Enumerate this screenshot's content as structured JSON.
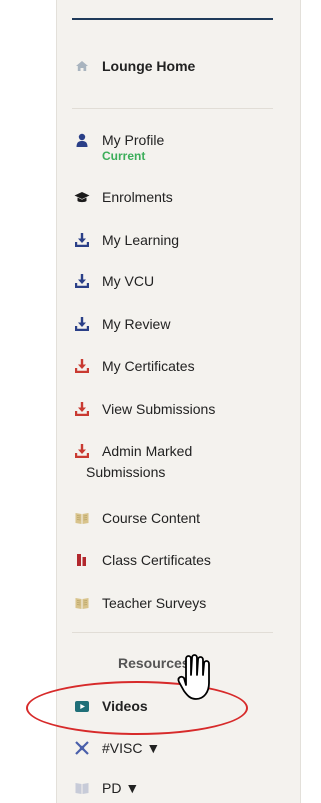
{
  "nav": {
    "home": "Lounge Home",
    "profile": {
      "label": "My Profile",
      "status": "Current"
    },
    "enrolments": "Enrolments",
    "my_learning": "My Learning",
    "my_vcu": "My VCU",
    "my_review": "My Review",
    "my_certificates": "My Certificates",
    "view_submissions": "View Submissions",
    "admin_marked_line1": "Admin Marked",
    "admin_marked_line2": "Submissions",
    "course_content": "Course Content",
    "class_certificates": "Class Certificates",
    "teacher_surveys": "Teacher Surveys"
  },
  "resources": {
    "title": "Resources",
    "videos": "Videos",
    "visc": "#VISC",
    "visc_caret": "▼",
    "pd": "PD",
    "pd_caret": "▼"
  },
  "colors": {
    "accent_navy": "#1f3a5a",
    "download_blue": "#2a3f87",
    "download_red": "#c93a31",
    "book_tan": "#d8c38b",
    "current_green": "#3cae5a",
    "annotation_red": "#d72a2a",
    "video_teal": "#1f6f78"
  }
}
